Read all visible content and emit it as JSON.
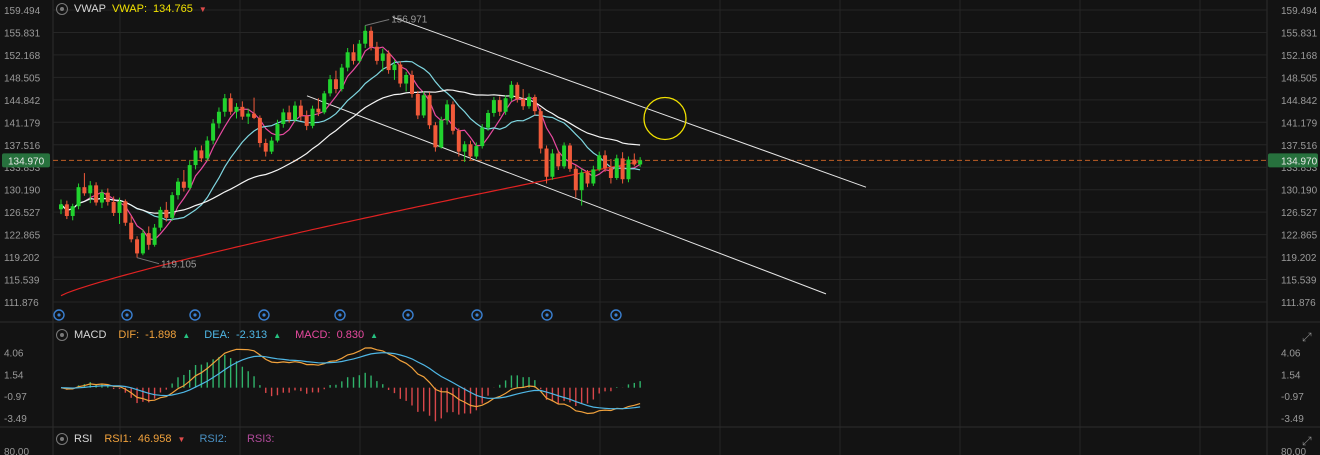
{
  "colors": {
    "background": "#131313",
    "grid": "#262626",
    "axis_text": "#9a9a9a",
    "candle_up": "#21d32e",
    "candle_down": "#f05a3a",
    "vwap": "#f0e68c",
    "ma_fast": "#e84aa0",
    "ma_mid": "#7fd6e0",
    "ma_slow": "#f4f4f4",
    "ma_long": "#e02222",
    "price_line": "#e8702a",
    "dif": "#f0a13c",
    "dea": "#4fb7e6",
    "macd_pos": "#2fb36a",
    "macd_neg": "#d9474a",
    "rsi1": "#f0a13c",
    "rsi2": "#4a90c2",
    "rsi3": "#b04a9a",
    "highlight_circle": "#f2e200",
    "event_marker": "#3a7fd0"
  },
  "main_header": {
    "indicator": "VWAP",
    "value_label": "VWAP:",
    "value": "134.765"
  },
  "macd_header": {
    "indicator": "MACD",
    "dif_label": "DIF:",
    "dif_value": "-1.898",
    "dea_label": "DEA:",
    "dea_value": "-2.313",
    "macd_label": "MACD:",
    "macd_value": "0.830"
  },
  "rsi_header": {
    "indicator": "RSI",
    "rsi1_label": "RSI1:",
    "rsi1_value": "46.958",
    "rsi2_label": "RSI2:",
    "rsi3_label": "RSI3:"
  },
  "chart_data": [
    {
      "type": "candlestick",
      "name": "price",
      "y_ticks": [
        "159.494",
        "155.831",
        "152.168",
        "148.505",
        "144.842",
        "141.179",
        "137.516",
        "133.853",
        "130.190",
        "126.527",
        "122.865",
        "119.202",
        "115.539",
        "111.876"
      ],
      "ylim": [
        111.876,
        159.494
      ],
      "current_price": "134.970",
      "high_label": "156.971",
      "low_label": "119.105",
      "high_value": 156.971,
      "low_value": 119.105,
      "event_marker_count": 9,
      "candles": [
        [
          127.0,
          128.6,
          126.2,
          127.8
        ],
        [
          127.8,
          128.4,
          125.4,
          125.9
        ],
        [
          125.9,
          127.9,
          125.2,
          127.5
        ],
        [
          127.5,
          131.2,
          127.0,
          130.6
        ],
        [
          130.6,
          132.9,
          129.2,
          129.6
        ],
        [
          129.6,
          131.6,
          128.0,
          130.9
        ],
        [
          130.9,
          131.4,
          127.6,
          128.1
        ],
        [
          128.1,
          130.2,
          127.2,
          129.7
        ],
        [
          129.7,
          130.4,
          127.6,
          128.2
        ],
        [
          128.2,
          129.1,
          125.9,
          126.4
        ],
        [
          126.4,
          128.9,
          124.6,
          128.3
        ],
        [
          128.3,
          128.6,
          124.3,
          124.8
        ],
        [
          124.8,
          125.9,
          121.6,
          122.1
        ],
        [
          122.1,
          122.6,
          119.1,
          119.8
        ],
        [
          119.8,
          123.7,
          119.5,
          123.1
        ],
        [
          123.1,
          124.2,
          120.4,
          121.2
        ],
        [
          121.2,
          124.6,
          120.9,
          124.0
        ],
        [
          124.0,
          127.4,
          123.5,
          126.9
        ],
        [
          126.9,
          128.2,
          125.0,
          125.6
        ],
        [
          125.6,
          129.8,
          125.1,
          129.3
        ],
        [
          129.3,
          132.1,
          128.6,
          131.5
        ],
        [
          131.5,
          133.4,
          129.9,
          130.5
        ],
        [
          130.5,
          134.9,
          130.1,
          134.2
        ],
        [
          134.2,
          137.1,
          133.5,
          136.6
        ],
        [
          136.6,
          137.4,
          134.7,
          135.3
        ],
        [
          135.3,
          138.9,
          134.9,
          138.2
        ],
        [
          138.2,
          141.7,
          137.6,
          141.0
        ],
        [
          141.0,
          143.6,
          140.2,
          142.9
        ],
        [
          142.9,
          145.8,
          142.1,
          145.1
        ],
        [
          145.1,
          145.9,
          142.4,
          142.9
        ],
        [
          142.9,
          144.3,
          141.8,
          143.7
        ],
        [
          143.7,
          144.6,
          141.6,
          142.1
        ],
        [
          142.1,
          143.4,
          140.9,
          142.6
        ],
        [
          142.6,
          145.2,
          141.7,
          141.9
        ],
        [
          141.9,
          142.3,
          137.1,
          137.8
        ],
        [
          137.8,
          138.5,
          135.6,
          136.4
        ],
        [
          136.4,
          138.8,
          136.0,
          138.2
        ],
        [
          138.2,
          141.6,
          137.9,
          140.9
        ],
        [
          140.9,
          143.4,
          140.3,
          142.8
        ],
        [
          142.8,
          143.9,
          141.1,
          141.6
        ],
        [
          141.6,
          144.6,
          141.2,
          143.9
        ],
        [
          143.9,
          144.8,
          141.4,
          142.2
        ],
        [
          142.2,
          143.1,
          139.9,
          140.6
        ],
        [
          140.6,
          143.9,
          140.2,
          143.4
        ],
        [
          143.4,
          145.1,
          142.2,
          142.8
        ],
        [
          142.8,
          146.3,
          142.5,
          145.9
        ],
        [
          145.9,
          148.9,
          145.4,
          148.2
        ],
        [
          148.2,
          149.6,
          145.9,
          146.6
        ],
        [
          146.6,
          150.7,
          146.2,
          150.1
        ],
        [
          150.1,
          153.3,
          149.5,
          152.6
        ],
        [
          152.6,
          153.9,
          150.6,
          151.2
        ],
        [
          151.2,
          154.6,
          150.8,
          154.0
        ],
        [
          154.0,
          156.97,
          153.3,
          156.1
        ],
        [
          156.1,
          156.8,
          152.9,
          153.5
        ],
        [
          153.5,
          154.3,
          150.6,
          151.2
        ],
        [
          151.2,
          153.2,
          149.5,
          152.4
        ],
        [
          152.4,
          152.9,
          149.1,
          149.7
        ],
        [
          149.7,
          151.3,
          148.1,
          150.6
        ],
        [
          150.6,
          151.1,
          146.9,
          147.5
        ],
        [
          147.5,
          149.4,
          146.2,
          148.9
        ],
        [
          148.9,
          149.6,
          145.2,
          145.8
        ],
        [
          145.8,
          146.3,
          141.7,
          142.3
        ],
        [
          142.3,
          146.2,
          141.9,
          145.6
        ],
        [
          145.6,
          146.1,
          140.1,
          140.7
        ],
        [
          140.7,
          141.2,
          136.4,
          137.1
        ],
        [
          137.1,
          142.1,
          136.9,
          141.5
        ],
        [
          141.5,
          144.8,
          140.8,
          144.1
        ],
        [
          144.1,
          144.6,
          139.2,
          139.8
        ],
        [
          139.8,
          140.2,
          135.6,
          136.4
        ],
        [
          136.4,
          138.1,
          134.7,
          137.6
        ],
        [
          137.6,
          138.2,
          135.1,
          135.6
        ],
        [
          135.6,
          137.9,
          135.2,
          137.3
        ],
        [
          137.3,
          140.9,
          136.9,
          140.3
        ],
        [
          140.3,
          143.2,
          139.8,
          142.7
        ],
        [
          142.7,
          145.3,
          142.1,
          144.8
        ],
        [
          144.8,
          145.4,
          142.2,
          142.9
        ],
        [
          142.9,
          145.6,
          142.4,
          145.1
        ],
        [
          145.1,
          147.9,
          144.6,
          147.3
        ],
        [
          147.3,
          147.7,
          144.4,
          145.0
        ],
        [
          145.0,
          146.6,
          143.2,
          143.8
        ],
        [
          143.8,
          145.9,
          143.4,
          145.3
        ],
        [
          145.3,
          145.7,
          142.3,
          143.0
        ],
        [
          143.0,
          143.5,
          136.1,
          136.9
        ],
        [
          136.9,
          137.4,
          131.2,
          132.3
        ],
        [
          132.3,
          136.8,
          131.8,
          136.1
        ],
        [
          136.1,
          136.6,
          133.4,
          134.0
        ],
        [
          134.0,
          137.9,
          133.6,
          137.4
        ],
        [
          137.4,
          137.8,
          133.1,
          133.6
        ],
        [
          133.6,
          134.2,
          128.9,
          130.1
        ],
        [
          130.1,
          133.6,
          127.6,
          133.0
        ],
        [
          133.0,
          133.4,
          130.6,
          131.2
        ],
        [
          131.2,
          134.1,
          130.8,
          133.5
        ],
        [
          133.5,
          136.4,
          133.2,
          135.8
        ],
        [
          135.8,
          136.6,
          133.1,
          133.7
        ],
        [
          133.7,
          135.2,
          131.2,
          132.1
        ],
        [
          132.1,
          135.9,
          131.8,
          135.3
        ],
        [
          135.3,
          136.3,
          131.2,
          131.9
        ],
        [
          131.9,
          135.6,
          131.4,
          135.1
        ],
        [
          135.1,
          136.1,
          134.0,
          134.3
        ],
        [
          134.3,
          135.5,
          133.9,
          134.97
        ]
      ]
    },
    {
      "type": "line",
      "name": "MACD",
      "y_ticks": [
        "4.06",
        "1.54",
        "-0.97",
        "-3.49"
      ],
      "ylim": [
        -4.4,
        4.9
      ],
      "dif_last": -1.898,
      "dea_last": -2.313,
      "macd_last": 0.83
    },
    {
      "type": "line",
      "name": "RSI",
      "y_ticks": [
        "80.00"
      ],
      "rsi1_last": 46.958
    }
  ]
}
